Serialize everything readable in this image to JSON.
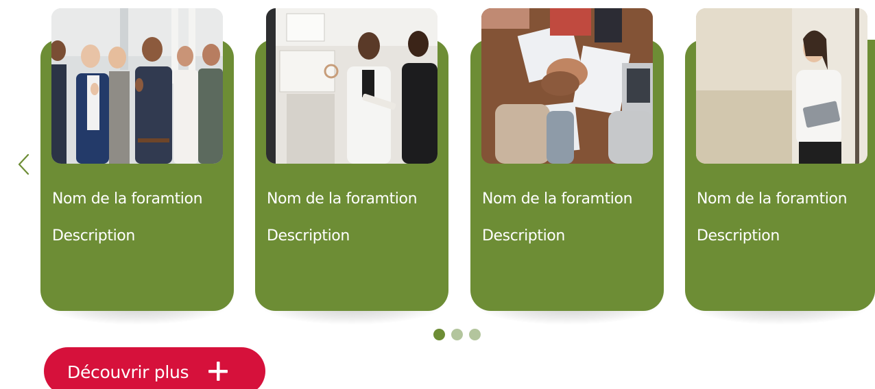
{
  "carousel": {
    "cards": [
      {
        "title": "Nom de la foramtion",
        "description": "Description",
        "photo": "team-thumbs-up-photo"
      },
      {
        "title": "Nom de la foramtion",
        "description": "Description",
        "photo": "office-meeting-photo"
      },
      {
        "title": "Nom de la foramtion",
        "description": "Description",
        "photo": "hands-together-photo"
      },
      {
        "title": "Nom de la foramtion",
        "description": "Description",
        "photo": "woman-tablet-photo"
      }
    ],
    "pagination": {
      "total": 3,
      "active": 1
    }
  },
  "cta": {
    "label": "Découvrir plus",
    "icon": "plus-icon"
  },
  "colors": {
    "card_green": "#6d8d35",
    "dot_active": "#6d8d35",
    "dot_inactive": "#b3c59d",
    "cta_red": "#d6113b",
    "arrow_green": "#6d8d35"
  }
}
